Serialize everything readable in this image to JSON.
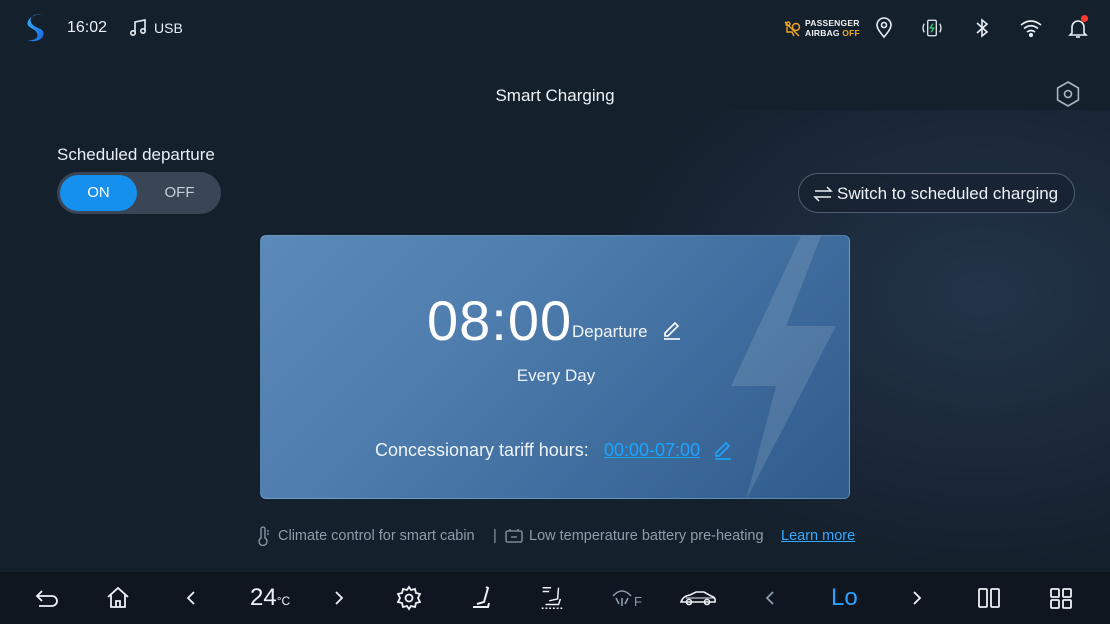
{
  "status": {
    "time": "16:02",
    "media_source": "USB",
    "airbag_line1": "PASSENGER",
    "airbag_line2_prefix": "AIRBAG",
    "airbag_line2_state": "OFF",
    "icons": [
      "s-logo-icon",
      "music-note-icon",
      "airbag-icon",
      "location-pin-icon",
      "phone-charging-icon",
      "bluetooth-icon",
      "wifi-icon",
      "bell-icon"
    ]
  },
  "page": {
    "title": "Smart Charging"
  },
  "departure": {
    "label": "Scheduled departure",
    "toggle_on": "ON",
    "toggle_off": "OFF",
    "selected": "ON"
  },
  "switch_button": {
    "label": "Switch to scheduled charging"
  },
  "card": {
    "time": "08:00",
    "time_label": "Departure",
    "repeat": "Every Day",
    "tariff_label": "Concessionary tariff hours:",
    "tariff_value": "00:00-07:00"
  },
  "info": {
    "climate": "Climate control for smart cabin",
    "separator": "|",
    "battery": "Low temperature battery pre-heating",
    "learn_more": "Learn more"
  },
  "bottom_bar": {
    "temperature": "24",
    "temperature_unit": "°C",
    "fan_level": "Lo",
    "defrost_label": "F"
  },
  "colors": {
    "background": "#15202d",
    "accent": "#1590ee",
    "link": "#35a9ff",
    "airbag_off": "#f2a623"
  }
}
